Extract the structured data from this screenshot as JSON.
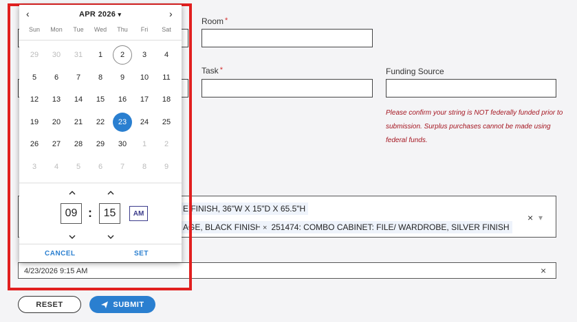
{
  "form": {
    "room_label": "Room",
    "task_label": "Task",
    "funding_label": "Funding Source",
    "required_mark": "*",
    "warning": "Please confirm your string is NOT federally funded prior to submission. Surplus purchases cannot be made using federal funds.",
    "items_line1": "E FINISH, 36\"W X 15\"D X 65.5\"H",
    "items_chip_a": "AGE, BLACK FINISH",
    "items_chip_b": "251474: COMBO CABINET: FILE/ WARDROBE, SILVER FINISH",
    "chip_remove": "×",
    "clear_all": "×",
    "dropdown_caret": "▾",
    "datetime_value": "4/23/2026 9:15 AM",
    "datetime_clear": "×",
    "reset_label": "RESET",
    "submit_label": "SUBMIT"
  },
  "picker": {
    "month_label": "APR 2026",
    "month_caret": "▾",
    "prev": "‹",
    "next": "›",
    "weekdays": [
      "Sun",
      "Mon",
      "Tue",
      "Wed",
      "Thu",
      "Fri",
      "Sat"
    ],
    "days": [
      "29",
      "30",
      "31",
      "1",
      "2",
      "3",
      "4",
      "5",
      "6",
      "7",
      "8",
      "9",
      "10",
      "11",
      "12",
      "13",
      "14",
      "15",
      "16",
      "17",
      "18",
      "19",
      "20",
      "21",
      "22",
      "23",
      "24",
      "25",
      "26",
      "27",
      "28",
      "29",
      "30",
      "1",
      "2",
      "3",
      "4",
      "5",
      "6",
      "7",
      "8",
      "9"
    ],
    "today_index": 4,
    "selected_index": 25,
    "muted_indices": [
      0,
      1,
      2,
      33,
      34,
      35,
      36,
      37,
      38,
      39,
      40,
      41
    ],
    "hour": "09",
    "minute": "15",
    "colon": ":",
    "ampm": "AM",
    "up": "^",
    "down": "v",
    "cancel_label": "CANCEL",
    "set_label": "SET"
  },
  "colors": {
    "accent": "#2a7fd0",
    "highlight_border": "#e11f1f",
    "warning": "#a4141f"
  }
}
